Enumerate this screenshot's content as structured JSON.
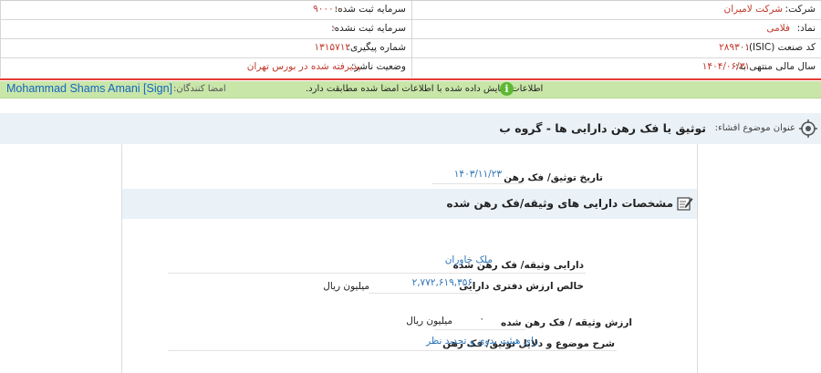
{
  "header": {
    "company_label": "شرکت:",
    "company_value": "شرکت لامیران",
    "capital_registered_label": "سرمایه ثبت شده:",
    "capital_registered_value": "۹۰۰۰۰۰",
    "symbol_label": "نماد:",
    "symbol_value": "فلامی",
    "capital_unregistered_label": "سرمایه ثبت نشده:",
    "capital_unregistered_value": "۰",
    "isic_label": "کد صنعت (ISIC):",
    "isic_value": "۲۸۹۳۰۱",
    "tracking_label": "شماره پیگیری:",
    "tracking_value": "۱۳۱۵۷۱۲",
    "fiscal_label": "سال مالی منتهی به:",
    "fiscal_value": "۱۴۰۴/۰۶/۳۱",
    "publisher_status_label": "وضعیت ناشر:",
    "publisher_status_value": "پذیرفته شده در بورس تهران"
  },
  "status_bar": {
    "message": "اطلاعات نمایش داده شده با اطلاعات امضا شده مطابقت دارد.",
    "signers_label": "امضا کنندگان:",
    "signer": "Mohammad Shams Amani [Sign]",
    "accent_color": "#c8e6a8"
  },
  "subject": {
    "label": "عنوان موضوع افشاء:",
    "title": "توثیق یا فک رهن دارایی ها - گروه ب"
  },
  "form": {
    "date_label": "تاریخ توثیق/ فک رهن",
    "date_value": "۱۴۰۳/۱۱/۲۳",
    "section_title": "مشخصات دارایی های وثیقه/فک رهن شده",
    "asset_label": "دارایی وثیقه/ فک رهن شده",
    "asset_value": "ملک خاوران",
    "book_value_label": "خالص ارزش دفتری دارایی",
    "book_value": "۲,۷۷۲,۶۱۹,۳۵۶",
    "book_value_unit": "میلیون ریال",
    "collateral_label": "ارزش وثیقه / فک رهن شده",
    "collateral_value": "۰",
    "collateral_unit": "میلیون ریال",
    "reason_label": "شرح موضوع و دلایل توثیق/ فک رهن",
    "reason_value": "رای هیئت بدوی و تجدید نظر"
  }
}
